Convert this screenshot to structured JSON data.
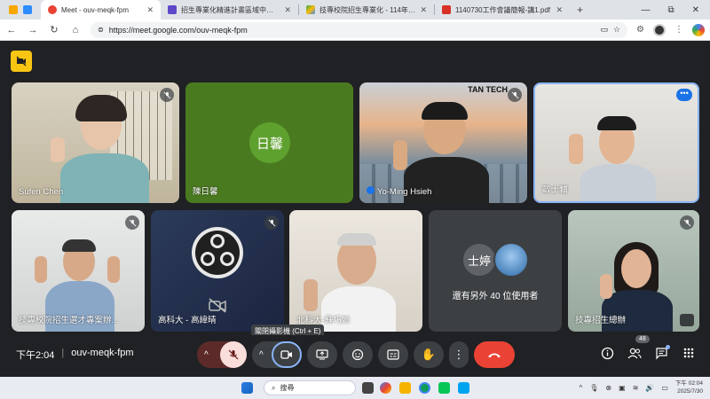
{
  "browser": {
    "tabs": [
      {
        "title": "Meet - ouv-meqk-fpm",
        "color": "#1a73e8",
        "active": true
      },
      {
        "title": "招生專業化精進計畫區域中心學校",
        "color": "#5f48c9",
        "active": false
      },
      {
        "title": "技專校院招生專業化 - 114年度辦理",
        "color": "#4285f4",
        "active": false
      },
      {
        "title": "1140730工作會議簡報-講1.pdf",
        "color": "#d93025",
        "active": false
      }
    ],
    "new_tab": "+",
    "window_controls": {
      "minimize": "—",
      "restore": "⧉",
      "close": "✕"
    },
    "nav": {
      "back": "←",
      "forward": "→",
      "reload": "↻",
      "home": "⌂"
    },
    "url": "https://meet.google.com/ouv-meqk-fpm"
  },
  "meeting": {
    "participants": [
      {
        "name": "Sufen Chen"
      },
      {
        "name": "陳日馨",
        "initials": "日馨",
        "avatar_color": "#4e9a2a"
      },
      {
        "name": "Yo-Ming Hsieh",
        "backdrop_text": "TAN TECH"
      },
      {
        "name": "歐士輔"
      },
      {
        "name": "技專校院招生選才專案辦..."
      },
      {
        "name": "高科大 - 高緯晴"
      },
      {
        "name": "北科大-蘇巧如"
      },
      {
        "name": "技專招生總辦"
      }
    ],
    "others": {
      "text": "還有另外 40 位使用者",
      "initials": "士婷"
    },
    "time": "下午2:04",
    "meeting_code": "ouv-meqk-fpm",
    "camera_tooltip": "關閉攝影機 (Ctrl + E)",
    "people_count": "48"
  },
  "taskbar": {
    "search_placeholder": "搜尋",
    "time": "下午 02:04",
    "date": "2025/7/30"
  },
  "colors": {
    "meet_bg": "#202124",
    "end_call": "#ea4335",
    "mic_off": "#f9dedc",
    "accent_blue": "#8ab4f8"
  }
}
